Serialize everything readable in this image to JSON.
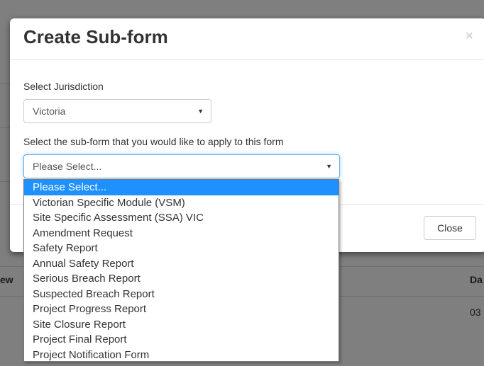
{
  "background": {
    "col_left_fragment": "ew",
    "col_right_fragment": "Da",
    "row_value_fragment": "03"
  },
  "modal": {
    "title": "Create Sub-form",
    "close_icon": "×",
    "jurisdiction_label": "Select Jurisdiction",
    "jurisdiction_value": "Victoria",
    "subform_label": "Select the sub-form that you would like to apply to this form",
    "subform_value": "Please Select...",
    "close_button": "Close"
  },
  "dropdown": {
    "selected_index": 0,
    "options": [
      "Please Select...",
      "Victorian Specific Module (VSM)",
      "Site Specific Assessment (SSA) VIC",
      "Amendment Request",
      "Safety Report",
      "Annual Safety Report",
      "Serious Breach Report",
      "Suspected Breach Report",
      "Project Progress Report",
      "Site Closure Report",
      "Project Final Report",
      "Project Notification Form"
    ]
  },
  "colors": {
    "highlight": "#1e90ff",
    "focus_border": "#66afe9"
  }
}
